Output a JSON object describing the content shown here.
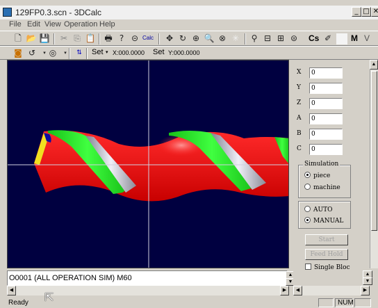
{
  "window": {
    "title": "129FP0.3.scn - 3DCalc"
  },
  "title_buttons": {
    "minimize": "_",
    "maximize": "□",
    "close": "✕"
  },
  "menu": [
    "File",
    "Edit",
    "View",
    "Operation",
    "Help"
  ],
  "toolbar1": {
    "calc_label": "Calc",
    "cs_label": "Cs",
    "m_label": "M",
    "v_label": "V"
  },
  "toolbar2": {
    "set_label": "Set",
    "x_readout": "X:000.0000",
    "set2_label": "Set",
    "y_readout": "Y:000.0000"
  },
  "axes": [
    {
      "label": "X",
      "value": "0"
    },
    {
      "label": "Y",
      "value": "0"
    },
    {
      "label": "Z",
      "value": "0"
    },
    {
      "label": "A",
      "value": "0"
    },
    {
      "label": "B",
      "value": "0"
    },
    {
      "label": "C",
      "value": "0"
    }
  ],
  "simulation": {
    "title": "Simulation",
    "options": [
      {
        "label": "piece",
        "selected": true
      },
      {
        "label": "machine",
        "selected": false
      }
    ]
  },
  "mode": {
    "options": [
      {
        "label": "AUTO",
        "selected": false
      },
      {
        "label": "MANUAL",
        "selected": true
      }
    ]
  },
  "buttons": {
    "start": "Start",
    "feed_hold": "Feed Hold"
  },
  "single_block": "Single Bloc",
  "code_line": "O0001     (ALL OPERATION SIM) M60",
  "status": {
    "ready": "Ready",
    "num": "NUM"
  },
  "colors": {
    "viewport_bg": "#000040",
    "tool_red": "#e81818",
    "flute_green": "#20e020",
    "tip_yellow": "#f0e020"
  }
}
